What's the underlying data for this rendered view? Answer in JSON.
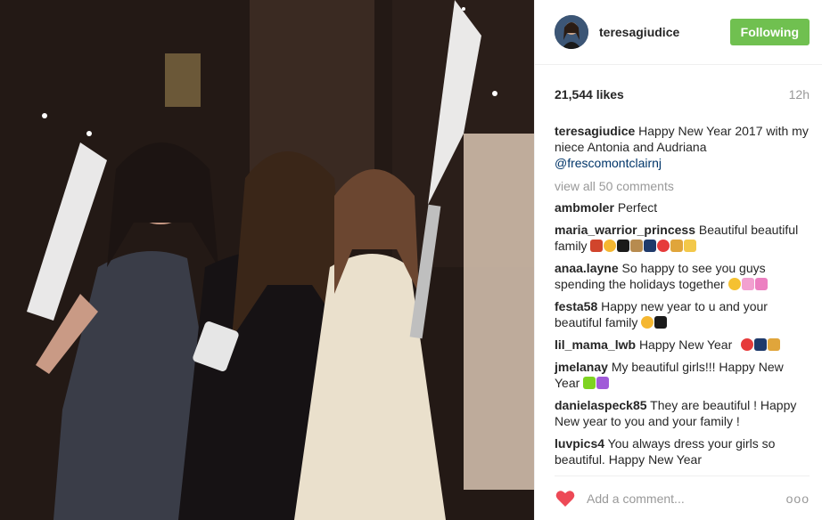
{
  "header": {
    "username": "teresagiudice",
    "follow_label": "Following",
    "follow_color": "#70c050"
  },
  "meta": {
    "likes": "21,544 likes",
    "time": "12h"
  },
  "caption": {
    "user": "teresagiudice",
    "text": "Happy New Year 2017 with my niece Antonia and Audriana",
    "mention": "@frescomontclairnj"
  },
  "view_all": "view all 50 comments",
  "comments": [
    {
      "user": "ambmoler",
      "text": "Perfect",
      "emoji": []
    },
    {
      "user": "maria_warrior_princess",
      "text": "Beautiful beautiful family",
      "emoji": [
        "dancer-emoji",
        "kiss-emoji",
        "heart-emoji",
        "champagne-emoji",
        "fireworks-emoji",
        "balloon-emoji",
        "confetti-emoji",
        "party-emoji"
      ]
    },
    {
      "user": "anaa.layne",
      "text": "So happy to see you guys spending the holidays together",
      "emoji": [
        "hug-emoji",
        "hearts-emoji",
        "hearts-emoji"
      ]
    },
    {
      "user": "festa58",
      "text": "Happy new year to u and your beautiful family",
      "emoji": [
        "kiss-emoji",
        "heart-emoji"
      ]
    },
    {
      "user": "lil_mama_lwb",
      "text": "Happy New Year",
      "emoji": [
        "balloon-emoji",
        "fireworks-emoji",
        "confetti-emoji"
      ]
    },
    {
      "user": "jmelanay",
      "text": "My beautiful girls!!! Happy New Year",
      "emoji": [
        "green-heart-emoji",
        "purple-heart-emoji"
      ]
    },
    {
      "user": "danielaspeck85",
      "text": "They are beautiful ! Happy New year to you and your family !",
      "emoji": []
    },
    {
      "user": "luvpics4",
      "text": "You always dress your girls so beautiful. Happy New Year",
      "emoji": []
    }
  ],
  "footer": {
    "placeholder": "Add a comment...",
    "more": "ooo",
    "heart_color": "#ed4956"
  }
}
